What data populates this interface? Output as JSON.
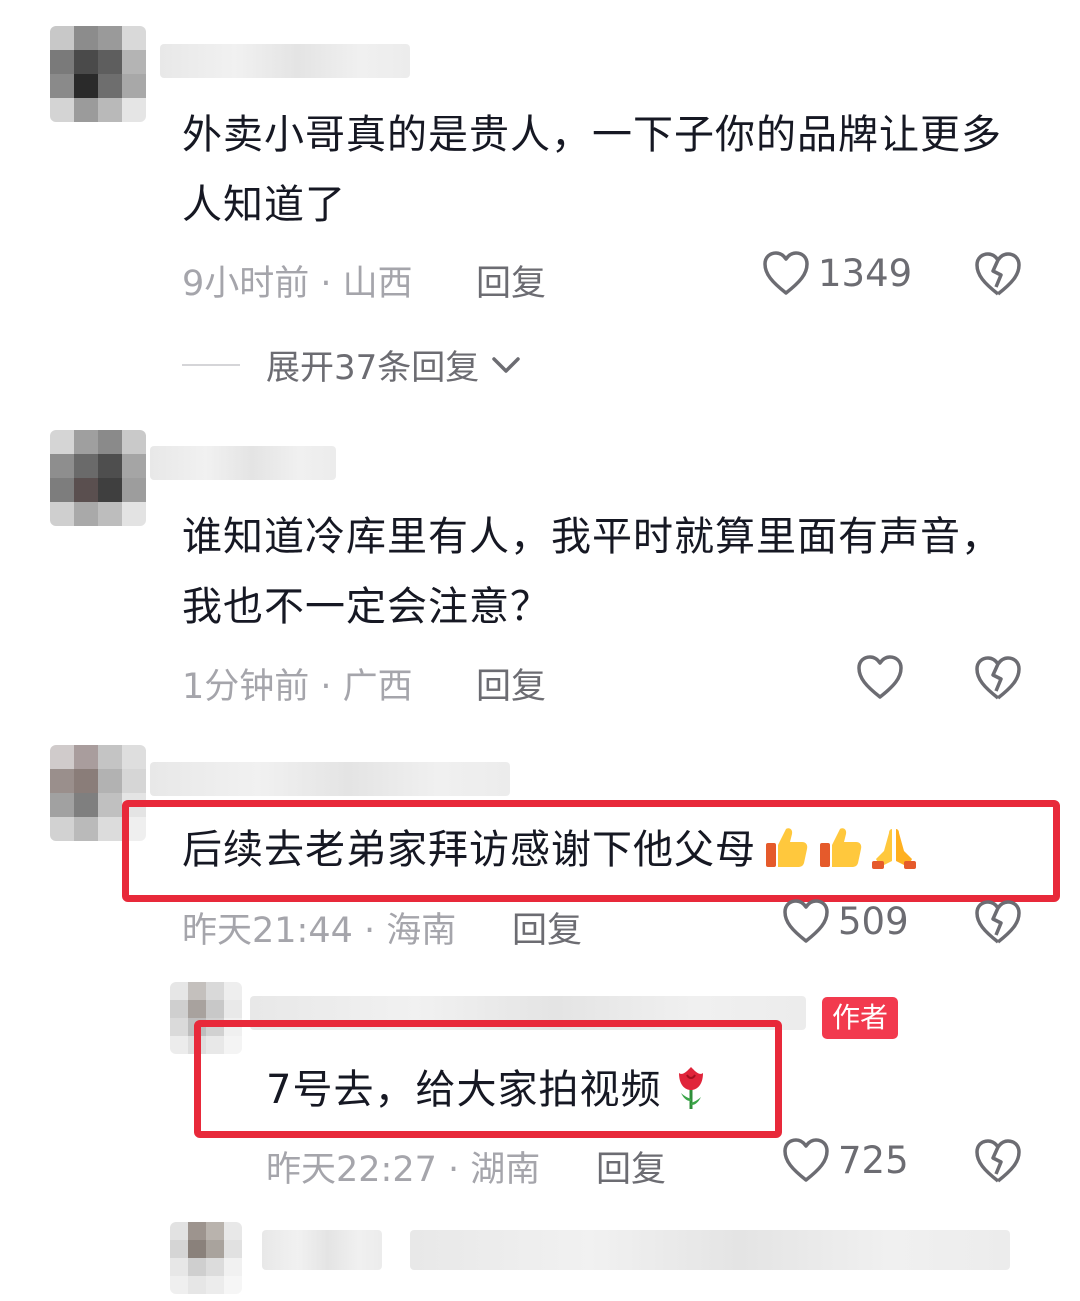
{
  "comments": [
    {
      "text": "外卖小哥真的是贵人，一下子你的品牌让更多人知道了",
      "time": "9小时前",
      "location": "山西",
      "reply_label": "回复",
      "likes": "1349",
      "expand_label": "展开37条回复"
    },
    {
      "text": "谁知道冷库里有人，我平时就算里面有声音，我也不一定会注意？",
      "time": "1分钟前",
      "location": "广西",
      "reply_label": "回复",
      "likes": ""
    },
    {
      "text": "后续去老弟家拜访感谢下他父母",
      "emojis": [
        "thumbs-up",
        "thumbs-up",
        "folded-hands"
      ],
      "time": "昨天21:44",
      "location": "海南",
      "reply_label": "回复",
      "likes": "509"
    }
  ],
  "author_reply": {
    "badge": "作者",
    "text": "7号去，给大家拍视频",
    "emoji": "rose",
    "time": "昨天22:27",
    "location": "湖南",
    "reply_label": "回复",
    "likes": "725"
  },
  "meta_separator": " · ",
  "colors": {
    "highlight": "#e8293a",
    "author_badge": "#f23a4e",
    "meta_text": "#a5a5ab"
  },
  "icons": [
    "heart-outline-icon",
    "broken-heart-icon",
    "chevron-down-icon"
  ]
}
